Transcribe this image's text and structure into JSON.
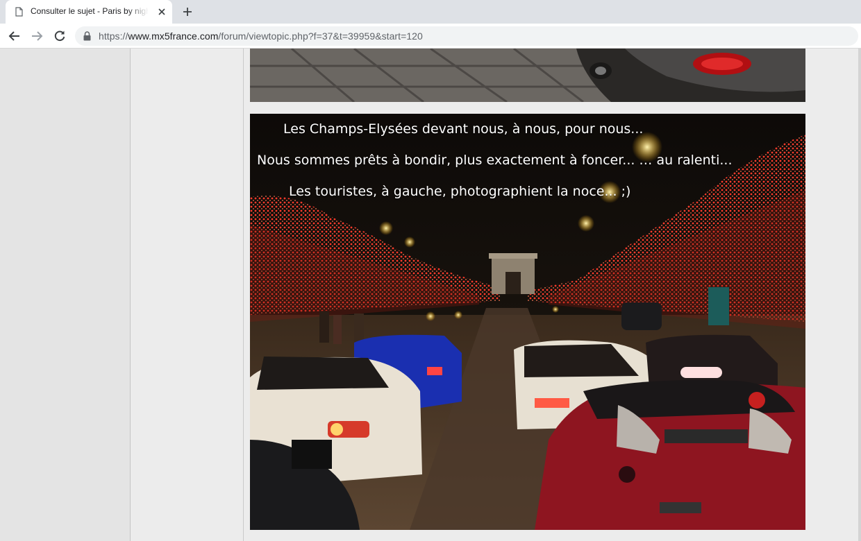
{
  "browser": {
    "tab_title": "Consulter le sujet - Paris by night",
    "url_scheme": "https://",
    "url_host": "www.mx5france.com",
    "url_path": "/forum/viewtopic.php?f=37&t=39959&start=120"
  },
  "post": {
    "image_caption_lines": [
      "Les Champs-Elysées devant nous, à nous, pour nous...",
      "Nous sommes prêts à bondir, plus exactement à foncer... … au ralenti...",
      "Les touristes, à gauche, photographient la noce...   ;)"
    ]
  },
  "colors": {
    "tabstrip": "#dee1e6",
    "page_background": "#ebebeb",
    "left_column": "#e4e4e4"
  }
}
